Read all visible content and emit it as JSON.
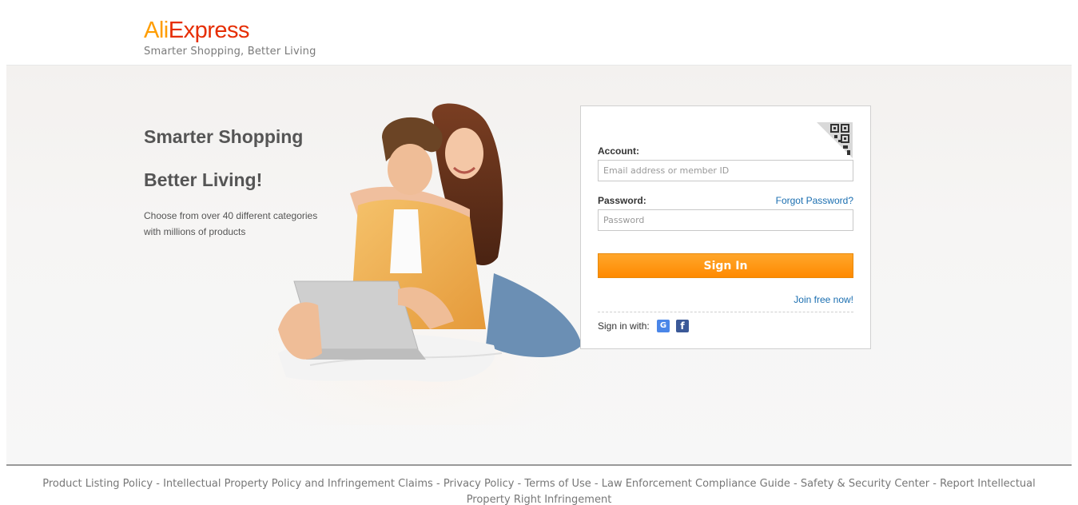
{
  "header": {
    "logo_ali": "Ali",
    "logo_express": "Express",
    "tagline": "Smarter Shopping, Better Living"
  },
  "hero": {
    "title_line1": "Smarter Shopping",
    "title_line2": "Better Living!",
    "description": "Choose from over 40 different categories with millions of products"
  },
  "login": {
    "account_label": "Account:",
    "account_placeholder": "Email address or member ID",
    "password_label": "Password:",
    "password_placeholder": "Password",
    "forgot_password": "Forgot Password?",
    "signin_button": "Sign In",
    "join_free": "Join free now!",
    "sign_in_with": "Sign in with:",
    "google_glyph": "G",
    "facebook_glyph": "f",
    "qr_icon": "qr-code-icon"
  },
  "footer": {
    "links": [
      "Product Listing Policy",
      "Intellectual Property Policy and Infringement Claims",
      "Privacy Policy",
      "Terms of Use",
      "Law Enforcement Compliance Guide",
      "Safety & Security Center",
      "Report Intellectual Property Right Infringement"
    ],
    "separator": " - "
  },
  "colors": {
    "brand_orange": "#ff9d00",
    "brand_red": "#e62e04",
    "link_blue": "#1a6eb0",
    "button_orange": "#ff8a00"
  }
}
